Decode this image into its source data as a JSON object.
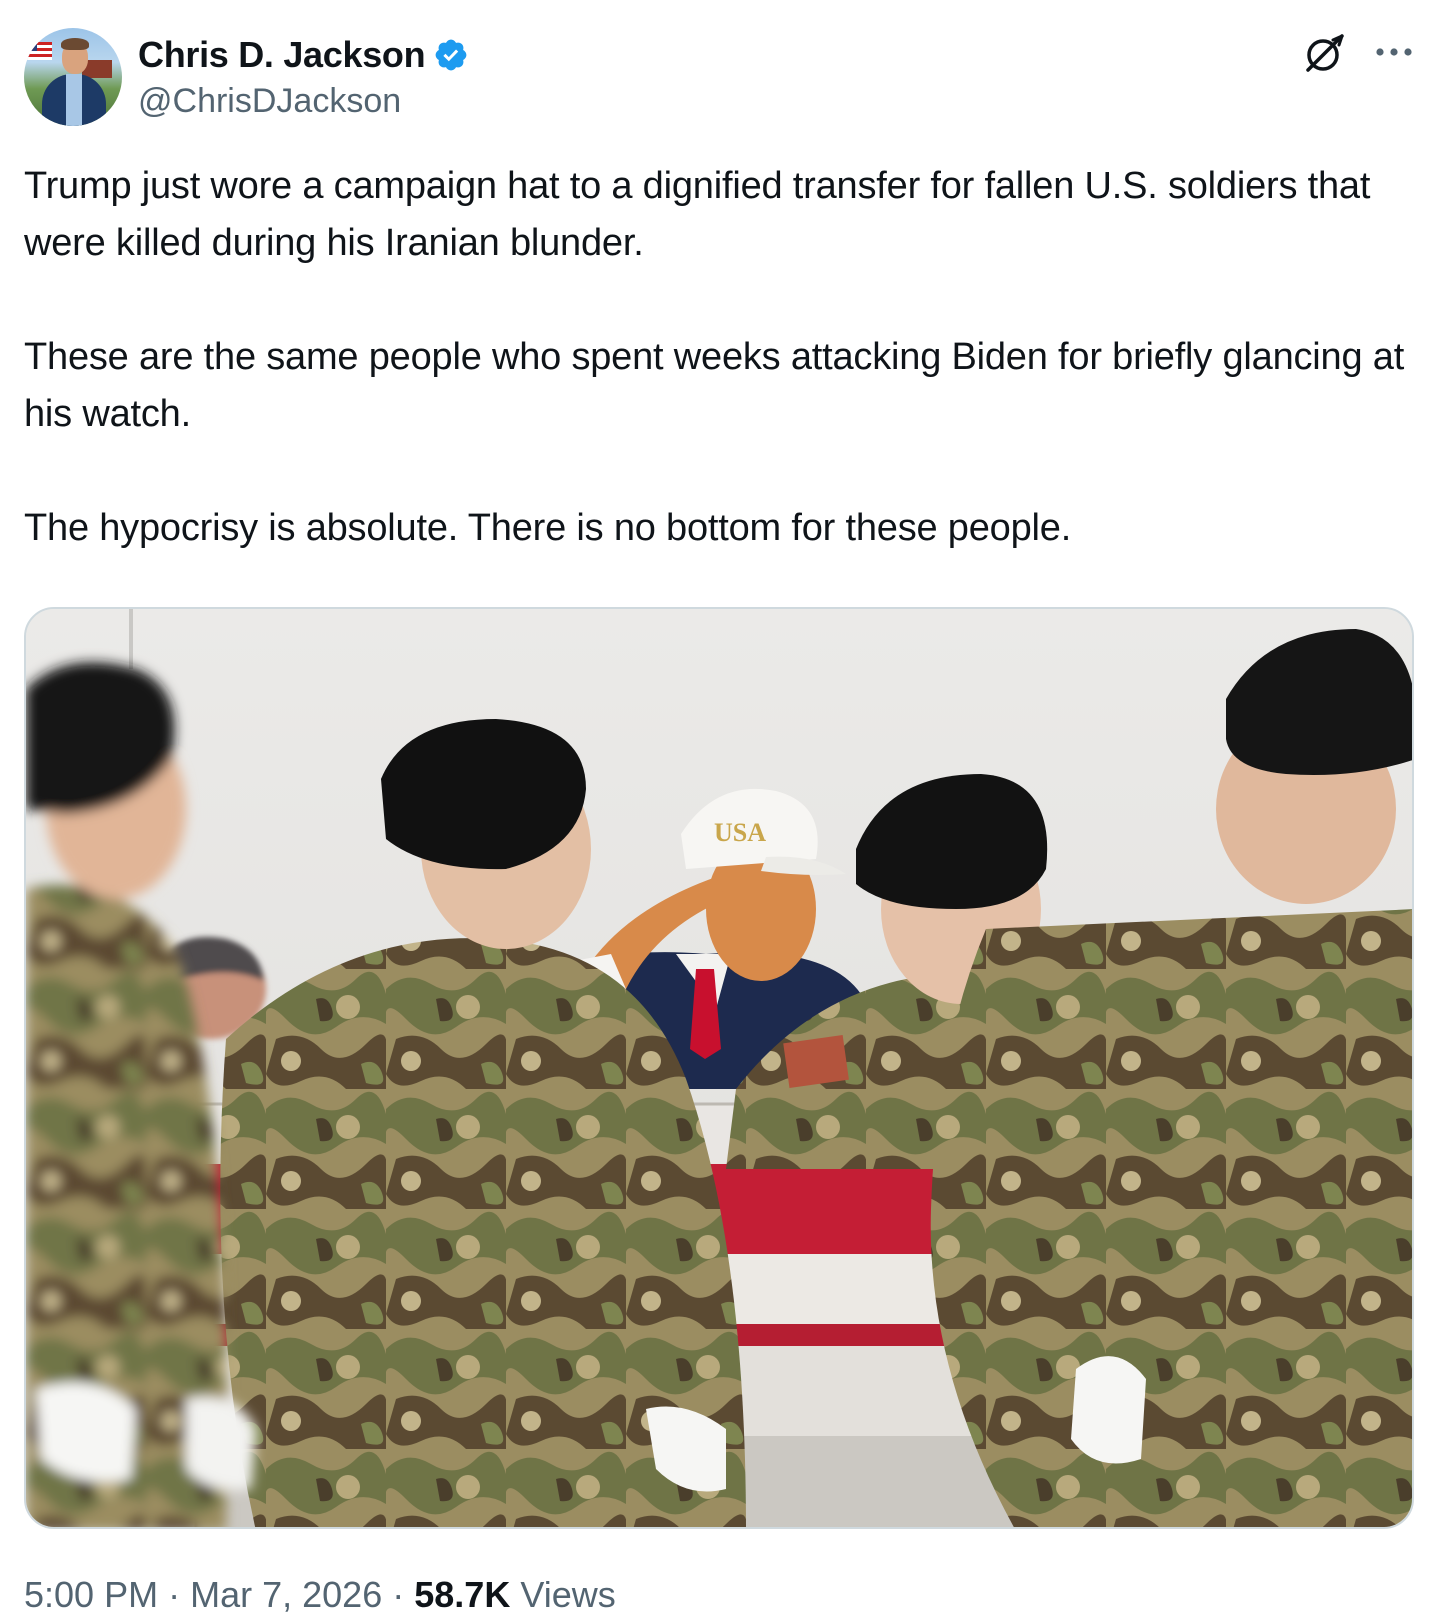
{
  "author": {
    "display_name": "Chris D. Jackson",
    "handle": "@ChrisDJackson",
    "verified": true,
    "verified_color": "#1d9bf0"
  },
  "icons": {
    "grok": "grok-icon",
    "more": "more-icon",
    "verified": "verified-badge-icon"
  },
  "tweet": {
    "paragraphs": [
      "Trump just wore a campaign hat to a dignified transfer for fallen U.S. soldiers that were killed during his Iranian blunder.",
      "These are the same people who spent weeks attacking Biden for briefly glancing at his watch.",
      "The hypocrisy is absolute. There is no bottom for these people."
    ]
  },
  "media": {
    "hat_text": "USA"
  },
  "meta": {
    "time": "5:00 PM",
    "separator": "·",
    "date": "Mar 7, 2026",
    "views_count": "58.7K",
    "views_label": "Views"
  },
  "colors": {
    "text": "#0f1419",
    "secondary": "#536471",
    "border": "#cfd9de"
  }
}
